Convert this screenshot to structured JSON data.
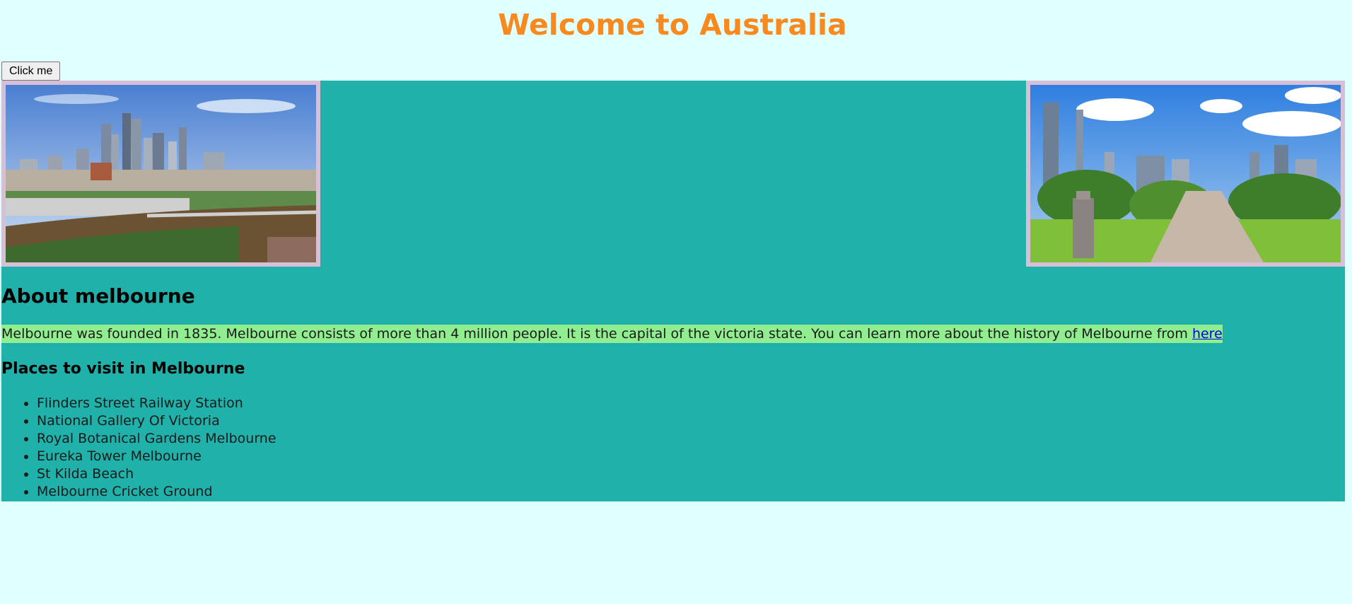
{
  "header": {
    "title": "Welcome to Australia"
  },
  "toolbar": {
    "button_label": "Click me"
  },
  "images": {
    "left": "melbourne-skyline-river-photo",
    "right": "melbourne-park-skyline-photo"
  },
  "about": {
    "heading": "About melbourne",
    "text": "Melbourne was founded in 1835. Melbourne consists of more than 4 million people. It is the capital of the victoria state. You can learn more about the history of Melbourne from ",
    "link_text": "here"
  },
  "places": {
    "heading": "Places to visit in Melbourne",
    "items": [
      "Flinders Street Railway Station",
      "National Gallery Of Victoria",
      "Royal Botanical Gardens Melbourne",
      "Eureka Tower Melbourne",
      "St Kilda Beach",
      "Melbourne Cricket Ground"
    ]
  },
  "colors": {
    "page_background": "#e0ffff",
    "title": "#f7891e",
    "content_background": "#20b2aa",
    "image_frame": "#d8bfd8",
    "paragraph_highlight": "#90ee90",
    "link": "#0000ee"
  }
}
